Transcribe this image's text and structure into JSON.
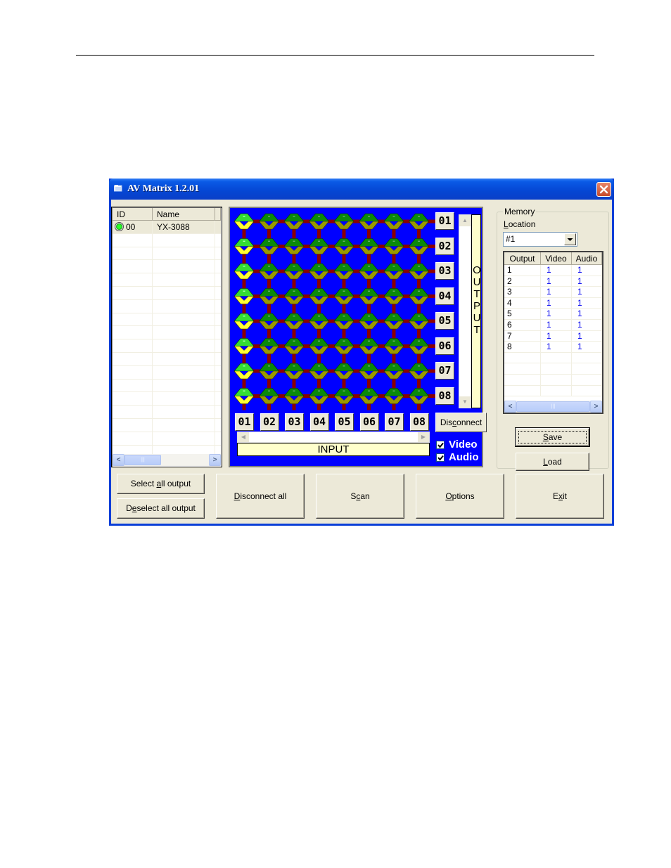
{
  "window": {
    "title": "AV Matrix 1.2.01",
    "close_icon": "close-x-icon",
    "app_icon": "folder-window-icon"
  },
  "device_list": {
    "columns": [
      "ID",
      "Name"
    ],
    "rows": [
      {
        "status_icon": "green-connected-icon",
        "id": "00",
        "name": "YX-3088"
      }
    ],
    "empty_rows": 17
  },
  "matrix": {
    "inputs": [
      "01",
      "02",
      "03",
      "04",
      "05",
      "06",
      "07",
      "08"
    ],
    "outputs": [
      "01",
      "02",
      "03",
      "04",
      "05",
      "06",
      "07",
      "08"
    ],
    "active_input_per_output": [
      1,
      1,
      1,
      1,
      1,
      1,
      1,
      1
    ],
    "output_label": "OUTPUT",
    "input_label": "INPUT",
    "disconnect_label": "Disconnect",
    "disconnect_accesskey": "c",
    "video_checkbox": {
      "label": "Video",
      "checked": true
    },
    "audio_checkbox": {
      "label": "Audio",
      "checked": true
    },
    "colors": {
      "background": "#0000FF",
      "wire": "#8B0000",
      "active_top": "#33DD33",
      "active_bottom": "#FFFF33",
      "inactive_top": "#0A8A0A",
      "inactive_bottom": "#999900"
    }
  },
  "memory": {
    "group_label": "Memory",
    "location_label": "Location",
    "location_value": "#1",
    "table": {
      "columns": [
        "Output",
        "Video",
        "Audio"
      ],
      "rows": [
        {
          "output": "1",
          "video": "1",
          "audio": "1"
        },
        {
          "output": "2",
          "video": "1",
          "audio": "1"
        },
        {
          "output": "3",
          "video": "1",
          "audio": "1"
        },
        {
          "output": "4",
          "video": "1",
          "audio": "1"
        },
        {
          "output": "5",
          "video": "1",
          "audio": "1"
        },
        {
          "output": "6",
          "video": "1",
          "audio": "1"
        },
        {
          "output": "7",
          "video": "1",
          "audio": "1"
        },
        {
          "output": "8",
          "video": "1",
          "audio": "1"
        }
      ]
    },
    "save_label": "Save",
    "load_label": "Load"
  },
  "buttons": {
    "select_all_output": "Select all output",
    "deselect_all_output": "Deselect all output",
    "disconnect_all": "Disconnect all",
    "scan": "Scan",
    "options": "Options",
    "exit": "Exit"
  }
}
